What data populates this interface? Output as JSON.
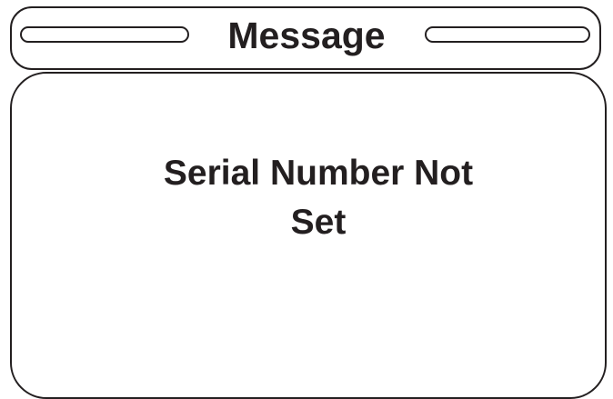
{
  "dialog": {
    "title": "Message",
    "message_lines": [
      "Serial Number Not",
      "Set"
    ]
  },
  "colors": {
    "ink": "#231f20",
    "background": "#ffffff"
  }
}
